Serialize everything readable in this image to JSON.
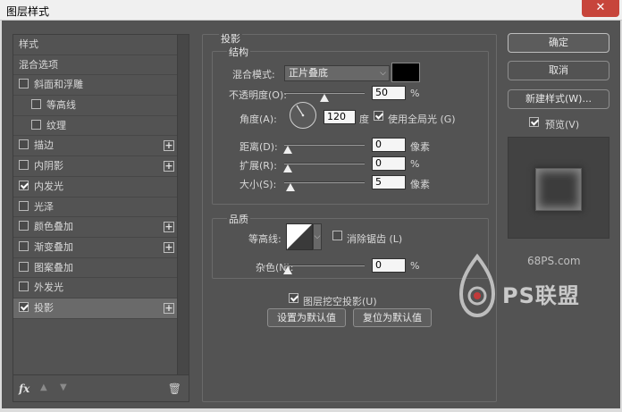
{
  "window": {
    "title": "图层样式",
    "close_label": "✕"
  },
  "left_list": {
    "items": [
      {
        "label": "样式",
        "checkbox": false,
        "checked": false,
        "plus": false,
        "indent": false,
        "selected": false
      },
      {
        "label": "混合选项",
        "checkbox": false,
        "checked": false,
        "plus": false,
        "indent": false,
        "selected": false
      },
      {
        "label": "斜面和浮雕",
        "checkbox": true,
        "checked": false,
        "plus": false,
        "indent": false,
        "selected": false
      },
      {
        "label": "等高线",
        "checkbox": true,
        "checked": false,
        "plus": false,
        "indent": true,
        "selected": false
      },
      {
        "label": "纹理",
        "checkbox": true,
        "checked": false,
        "plus": false,
        "indent": true,
        "selected": false
      },
      {
        "label": "描边",
        "checkbox": true,
        "checked": false,
        "plus": true,
        "indent": false,
        "selected": false
      },
      {
        "label": "内阴影",
        "checkbox": true,
        "checked": false,
        "plus": true,
        "indent": false,
        "selected": false
      },
      {
        "label": "内发光",
        "checkbox": true,
        "checked": true,
        "plus": false,
        "indent": false,
        "selected": false
      },
      {
        "label": "光泽",
        "checkbox": true,
        "checked": false,
        "plus": false,
        "indent": false,
        "selected": false
      },
      {
        "label": "颜色叠加",
        "checkbox": true,
        "checked": false,
        "plus": true,
        "indent": false,
        "selected": false
      },
      {
        "label": "渐变叠加",
        "checkbox": true,
        "checked": false,
        "plus": true,
        "indent": false,
        "selected": false
      },
      {
        "label": "图案叠加",
        "checkbox": true,
        "checked": false,
        "plus": false,
        "indent": false,
        "selected": false
      },
      {
        "label": "外发光",
        "checkbox": true,
        "checked": false,
        "plus": false,
        "indent": false,
        "selected": false
      },
      {
        "label": "投影",
        "checkbox": true,
        "checked": true,
        "plus": true,
        "indent": false,
        "selected": true
      }
    ],
    "footer": {
      "fx": "fx",
      "up": "▲",
      "down": "▼",
      "trash": "🗑"
    }
  },
  "drop_shadow": {
    "section_title": "投影",
    "structure": {
      "title": "结构",
      "blend_mode_label": "混合模式:",
      "blend_mode_value": "正片叠底",
      "opacity_label": "不透明度(O):",
      "opacity_value": "50",
      "opacity_unit": "%",
      "opacity_fraction": 0.5,
      "angle_label": "角度(A):",
      "angle_value": "120",
      "angle_unit": "度",
      "global_light_label": "使用全局光 (G)",
      "global_light_checked": true,
      "distance_label": "距离(D):",
      "distance_value": "0",
      "distance_unit": "像素",
      "spread_label": "扩展(R):",
      "spread_value": "0",
      "spread_unit": "%",
      "size_label": "大小(S):",
      "size_value": "5",
      "size_unit": "像素"
    },
    "quality": {
      "title": "品质",
      "contour_label": "等高线:",
      "anti_alias_label": "消除锯齿 (L)",
      "anti_alias_checked": false,
      "noise_label": "杂色(N):",
      "noise_value": "0",
      "noise_unit": "%"
    },
    "knockout_label": "图层挖空投影(U)",
    "knockout_checked": true,
    "make_default_label": "设置为默认值",
    "reset_default_label": "复位为默认值"
  },
  "right": {
    "ok_label": "确定",
    "cancel_label": "取消",
    "new_style_label": "新建样式(W)...",
    "preview_label": "预览(V)",
    "preview_checked": true
  },
  "watermark": {
    "site": "68PS.com",
    "brand": "PS联盟"
  },
  "colors": {
    "shadow_color": "#000000",
    "accent": "#535353"
  }
}
